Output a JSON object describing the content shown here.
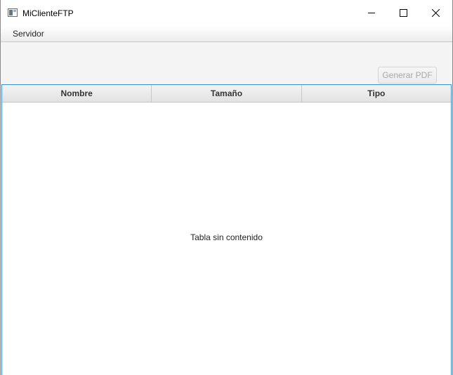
{
  "window": {
    "title": "MiClienteFTP"
  },
  "icons": {
    "app": "app-window-icon",
    "minimize": "minimize-icon",
    "maximize": "maximize-icon",
    "close": "close-icon"
  },
  "menubar": {
    "items": [
      {
        "label": "Servidor"
      }
    ]
  },
  "toolbar": {
    "pdf_button_label": "Generar PDF",
    "pdf_button_enabled": false
  },
  "table": {
    "columns": [
      {
        "label": "Nombre"
      },
      {
        "label": "Tamaño"
      },
      {
        "label": "Tipo"
      }
    ],
    "rows": [],
    "empty_text": "Tabla sin contenido"
  },
  "colors": {
    "focus_border": "#3a8fd6",
    "disabled_text": "#a8a8a8"
  }
}
